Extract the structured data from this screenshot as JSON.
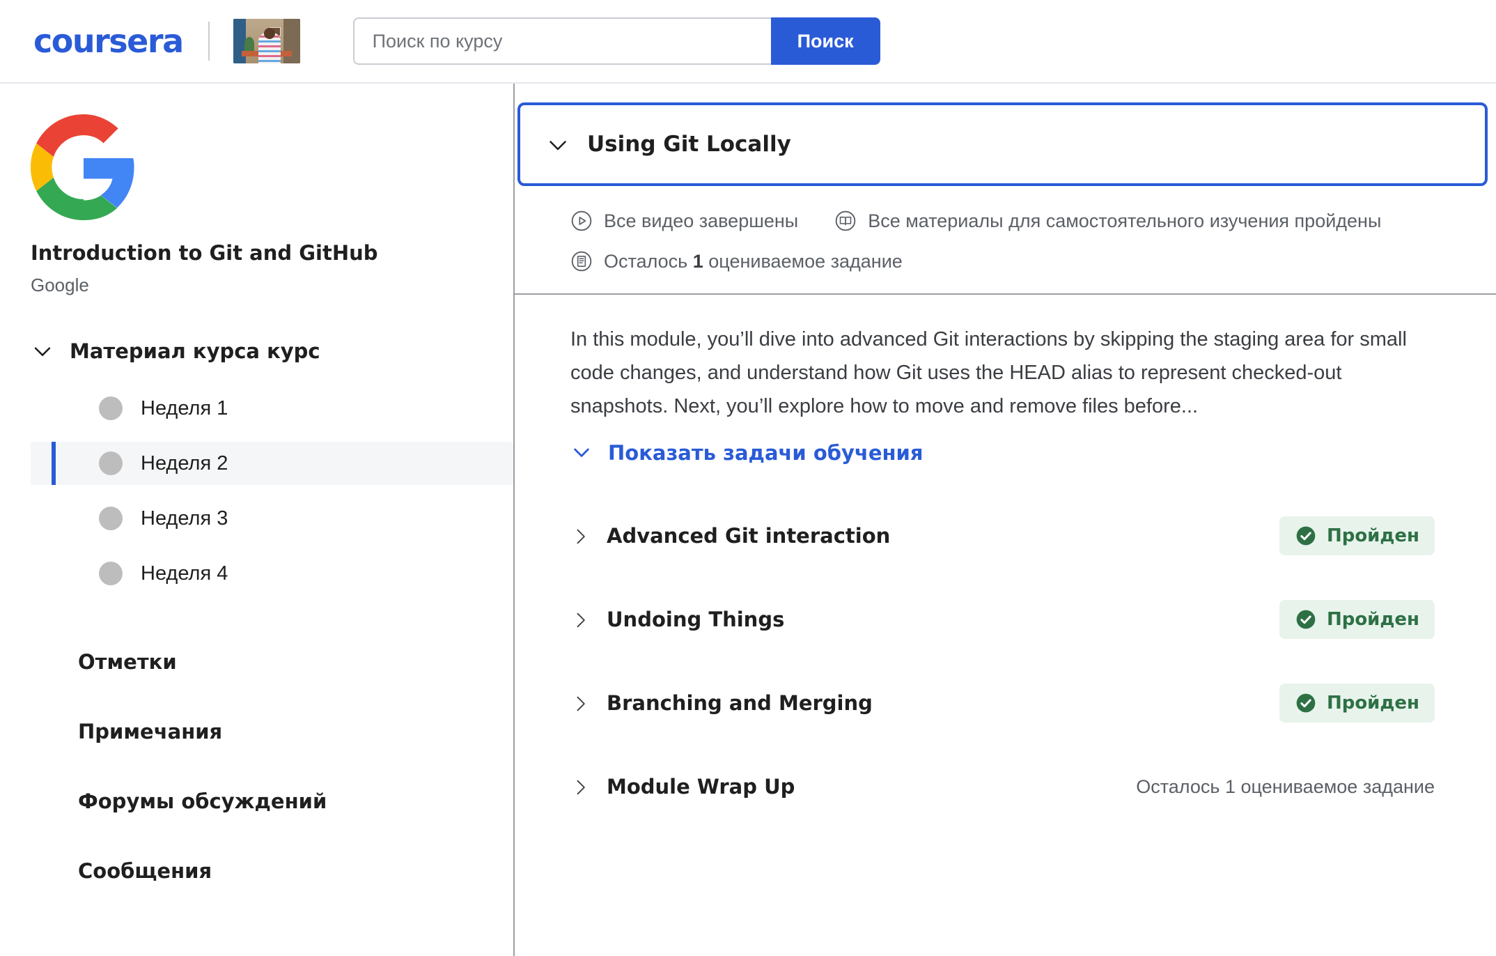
{
  "header": {
    "logo_text": "coursera",
    "partner_thumb_name": "course-partner-thumbnail",
    "search": {
      "placeholder": "Поиск по курсу",
      "value": "",
      "button_label": "Поиск"
    }
  },
  "sidebar": {
    "course_title": "Introduction to Git and GitHub",
    "course_partner": "Google",
    "section_label": "Материал курса курс",
    "weeks": [
      {
        "label": "Неделя 1",
        "active": false
      },
      {
        "label": "Неделя 2",
        "active": true
      },
      {
        "label": "Неделя 3",
        "active": false
      },
      {
        "label": "Неделя 4",
        "active": false
      }
    ],
    "nav_links": [
      {
        "label": "Отметки"
      },
      {
        "label": "Примечания"
      },
      {
        "label": "Форумы обсуждений"
      },
      {
        "label": "Сообщения"
      }
    ]
  },
  "main": {
    "module_title": "Using Git Locally",
    "status": {
      "videos": "Все видео завершены",
      "readings": "Все материалы для самостоятельного изучения пройдены",
      "assignments_prefix": "Осталось ",
      "assignments_count": "1",
      "assignments_suffix": " оцениваемое задание"
    },
    "description": "In this module, you’ll dive into advanced Git interactions by skipping the staging area for small code changes, and understand how Git uses the HEAD alias to represent checked-out snapshots. Next, you’ll explore how to move and remove files before...",
    "learning_objectives_link": "Показать задачи обучения",
    "lessons": [
      {
        "title": "Advanced Git interaction",
        "status_type": "badge",
        "status_text": "Пройден"
      },
      {
        "title": "Undoing Things",
        "status_type": "badge",
        "status_text": "Пройден"
      },
      {
        "title": "Branching and Merging",
        "status_type": "badge",
        "status_text": "Пройден"
      },
      {
        "title": "Module Wrap Up",
        "status_type": "plain",
        "status_text": "Осталось 1 оцениваемое задание"
      }
    ]
  },
  "colors": {
    "brand_blue": "#2a5bd7",
    "pass_green": "#2d7044",
    "pass_green_bg": "#e8f3ec",
    "google_red": "#ea4335",
    "google_yellow": "#fbbc05",
    "google_green": "#34a853",
    "google_blue": "#4285f4"
  }
}
